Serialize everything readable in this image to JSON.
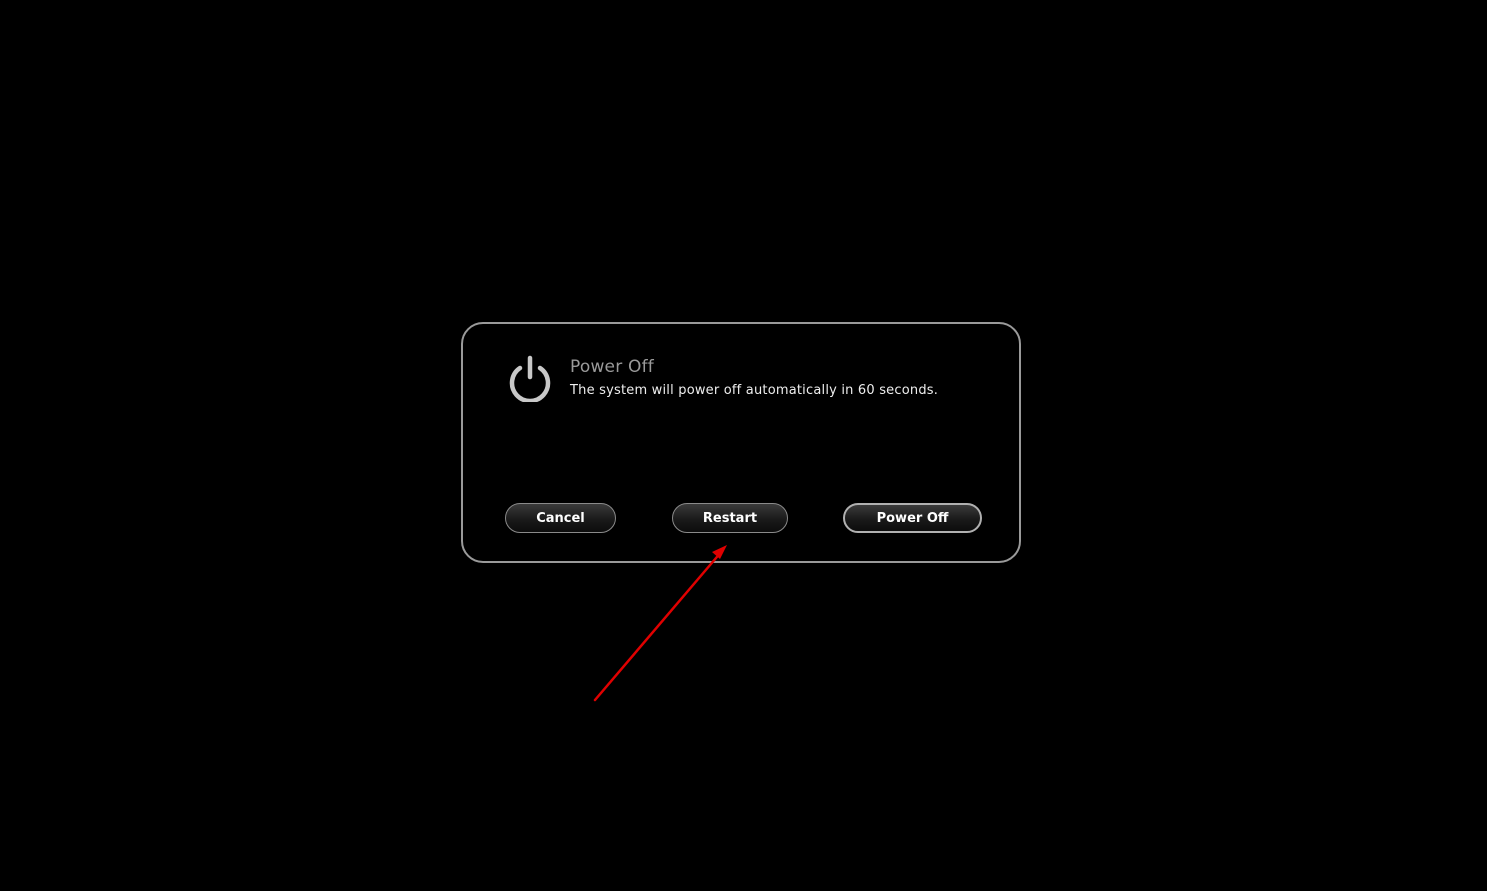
{
  "dialog": {
    "title": "Power Off",
    "message": "The system will power off automatically in 60 seconds.",
    "icon": "power-icon"
  },
  "buttons": {
    "cancel_label": "Cancel",
    "restart_label": "Restart",
    "power_off_label": "Power Off"
  },
  "colors": {
    "background": "#000000",
    "dialog_border": "#9a9a9a",
    "title_text": "#9a9a9a",
    "message_text": "#eeeeee",
    "annotation_arrow": "#e00000"
  }
}
